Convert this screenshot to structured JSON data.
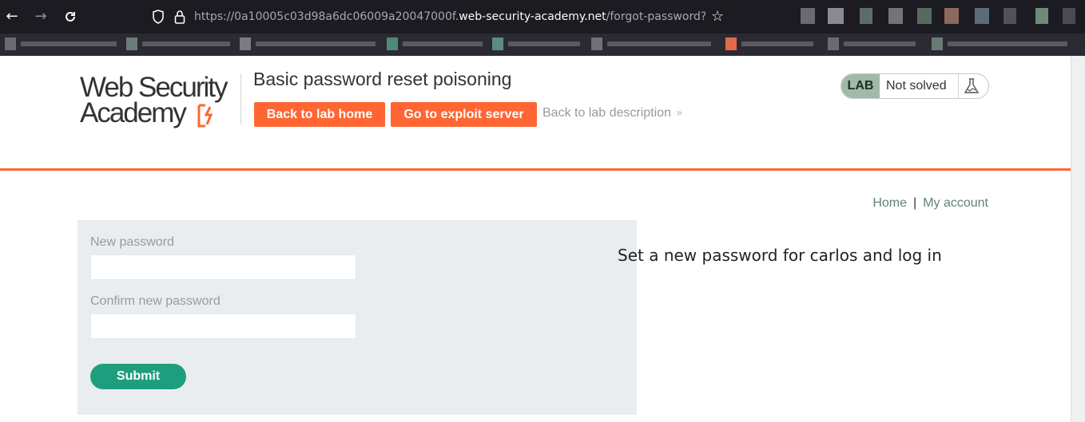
{
  "browser": {
    "url_prefix": "https://0a10005c03d98a6dc06009a20047000f.",
    "url_host": "web-security-academy.net",
    "url_path": "/forgot-password?temp-forgo",
    "back_icon": "arrow-left-icon",
    "forward_icon": "arrow-right-icon",
    "reload_icon": "reload-icon",
    "bookmark_icon": "star-icon"
  },
  "header": {
    "logo_line1": "Web Security",
    "logo_line2": "Academy",
    "lab_title": "Basic password reset poisoning",
    "back_to_lab_home": "Back to lab home",
    "go_to_exploit_server": "Go to exploit server",
    "back_to_lab_description": "Back to lab description",
    "back_arrow": "»",
    "lab_status_label": "LAB",
    "lab_status_text": "Not solved"
  },
  "nav": {
    "home": "Home",
    "separator": "|",
    "my_account": "My account"
  },
  "form": {
    "new_password_label": "New password",
    "new_password_value": "",
    "confirm_password_label": "Confirm new password",
    "confirm_password_value": "",
    "submit_label": "Submit"
  },
  "message": "Set a new password for carlos and log in",
  "colors": {
    "accent": "#ff6633",
    "submit": "#1f9e7d",
    "link": "#5e8375",
    "panel": "#eaedf0"
  }
}
